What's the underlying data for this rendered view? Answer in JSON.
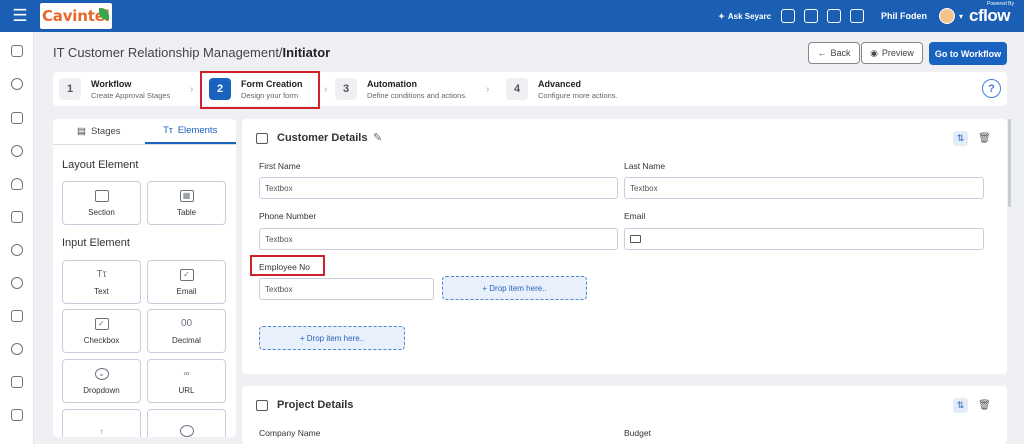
{
  "topbar": {
    "logo_text": "Cavintel",
    "ask_label": "Ask Seyarc",
    "user_name": "Phil Foden",
    "brand": "cflow",
    "brand_powered": "Powered By"
  },
  "header": {
    "breadcrumb": "IT Customer Relationship Management/",
    "breadcrumb_current": "Initiator",
    "back_label": "Back",
    "preview_label": "Preview",
    "goto_label": "Go to Workflow"
  },
  "stepper": {
    "steps": [
      {
        "num": "1",
        "title": "Workflow",
        "subtitle": "Create Approval Stages"
      },
      {
        "num": "2",
        "title": "Form Creation",
        "subtitle": "Design your form"
      },
      {
        "num": "3",
        "title": "Automation",
        "subtitle": "Define conditions and actions."
      },
      {
        "num": "4",
        "title": "Advanced",
        "subtitle": "Configure more actions."
      }
    ],
    "active_step": 2
  },
  "palette": {
    "tabs": [
      "Stages",
      "Elements"
    ],
    "active_tab": "Elements",
    "layout_heading": "Layout Element",
    "layout_items": [
      "Section",
      "Table"
    ],
    "input_heading": "Input Element",
    "input_items": [
      "Text",
      "Email",
      "Checkbox",
      "Decimal",
      "Dropdown",
      "URL"
    ]
  },
  "form": {
    "section1": {
      "title": "Customer Details",
      "first_name_label": "First Name",
      "last_name_label": "Last Name",
      "phone_label": "Phone Number",
      "email_label": "Email",
      "employee_no_label": "Employee No",
      "textbox_placeholder": "Textbox",
      "drop_label": "+ Drop item here.."
    },
    "section2": {
      "title": "Project Details",
      "company_label": "Company Name",
      "budget_label": "Budget"
    }
  },
  "colors": {
    "topbar": "#1a5fb4",
    "primary": "#1a62c0",
    "highlight": "#d0202a",
    "drop_zone": "#e8f0fb"
  }
}
